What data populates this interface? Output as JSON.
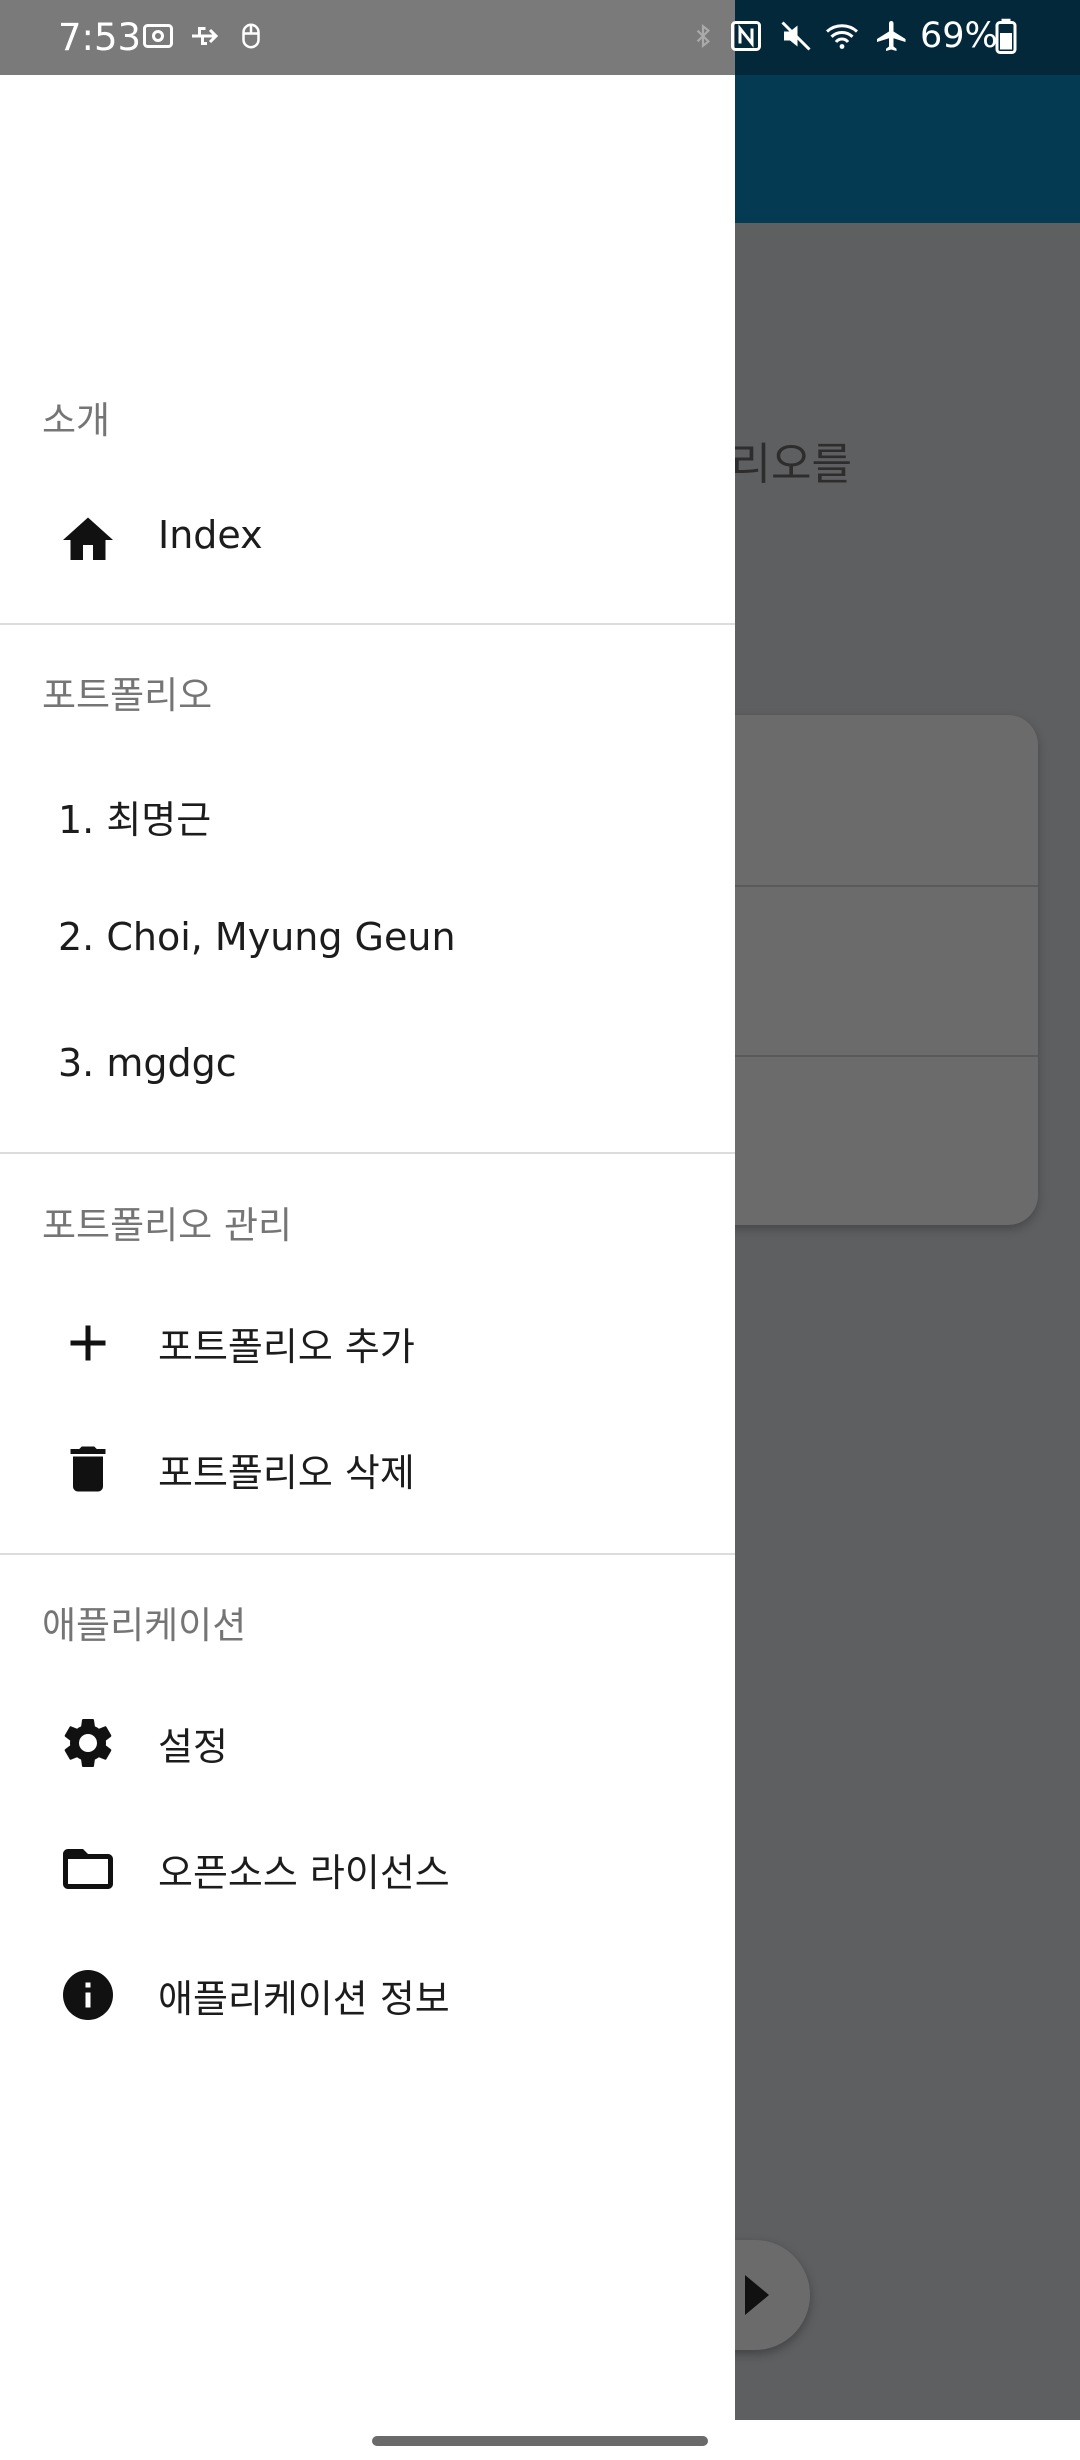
{
  "status_bar": {
    "time": "7:53",
    "battery": "69%",
    "icons": [
      "screenshot-icon",
      "usb-icon",
      "mouse-icon",
      "bluetooth-icon",
      "nfc-icon",
      "mute-icon",
      "wifi-icon",
      "airplane-icon",
      "battery-icon"
    ]
  },
  "background": {
    "partial_text": "폴리오를"
  },
  "drawer": {
    "sections": [
      {
        "title": "소개",
        "items": [
          {
            "label": "Index",
            "icon": "home-icon"
          }
        ]
      },
      {
        "title": "포트폴리오",
        "items": [
          {
            "label": "1. 최명근"
          },
          {
            "label": "2. Choi, Myung Geun"
          },
          {
            "label": "3. mgdgc"
          }
        ]
      },
      {
        "title": "포트폴리오 관리",
        "items": [
          {
            "label": "포트폴리오 추가",
            "icon": "add-icon"
          },
          {
            "label": "포트폴리오 삭제",
            "icon": "trash-icon"
          }
        ]
      },
      {
        "title": "애플리케이션",
        "items": [
          {
            "label": "설정",
            "icon": "gear-icon"
          },
          {
            "label": "오픈소스 라이선스",
            "icon": "folder-icon"
          },
          {
            "label": "애플리케이션 정보",
            "icon": "info-icon"
          }
        ]
      }
    ]
  }
}
